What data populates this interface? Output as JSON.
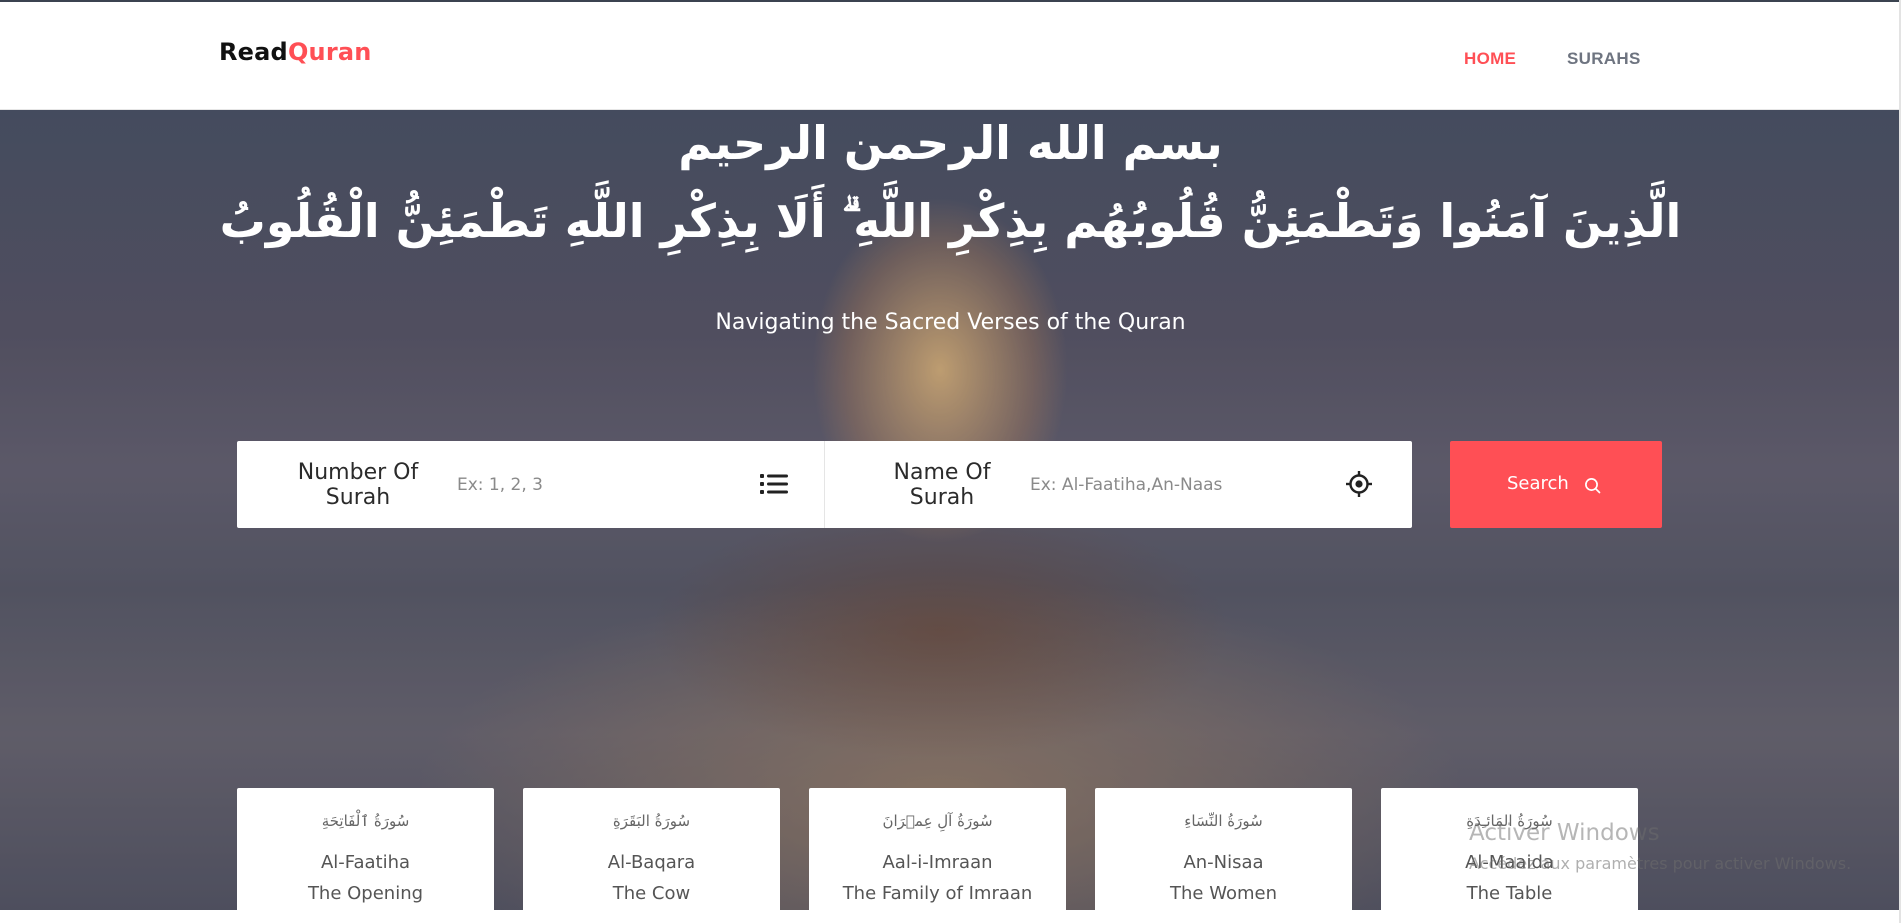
{
  "brand": {
    "part1": "Read",
    "part2": "Quran"
  },
  "nav": {
    "home": "HOME",
    "surahs": "SURAHS"
  },
  "hero": {
    "bismillah": "بسم الله الرحمن الرحيم",
    "verse": "الَّذِينَ آمَنُوا وَتَطْمَئِنُّ قُلُوبُهُم بِذِكْرِ اللَّهِ ۗ أَلَا بِذِكْرِ اللَّهِ تَطْمَئِنُّ الْقُلُوبُ",
    "tagline": "Navigating the Sacred Verses of the Quran"
  },
  "search": {
    "number_label_line1": "Number Of",
    "number_label_line2": "Surah",
    "number_placeholder": "Ex: 1, 2, 3",
    "name_label_line1": "Name Of",
    "name_label_line2": "Surah",
    "name_placeholder": "Ex: Al-Faatiha,An-Naas",
    "button_label": "Search"
  },
  "surahs": [
    {
      "arabic": "سُورَةُ ٱلْفَاتِحَةِ",
      "name": "Al-Faatiha",
      "translation": "The Opening"
    },
    {
      "arabic": "سُورَةُ البَقَرَةِ",
      "name": "Al-Baqara",
      "translation": "The Cow"
    },
    {
      "arabic": "سُورَةُ آلِ عِمۡرَانَ",
      "name": "Aal-i-Imraan",
      "translation": "The Family of Imraan"
    },
    {
      "arabic": "سُورَةُ النِّسَاءِ",
      "name": "An-Nisaa",
      "translation": "The Women"
    },
    {
      "arabic": "سُورَةُ المَائـِدَةِ",
      "name": "Al-Maaida",
      "translation": "The Table"
    }
  ],
  "watermark": {
    "title": "Activer Windows",
    "subtitle": "Accédez aux paramètres pour activer Windows."
  },
  "colors": {
    "accent": "#ff4f55",
    "text_dark": "#111111",
    "nav_muted": "#6e7480"
  },
  "icons": {
    "number_field": "list-icon",
    "name_field": "crosshair-icon",
    "search_button": "search-icon"
  }
}
